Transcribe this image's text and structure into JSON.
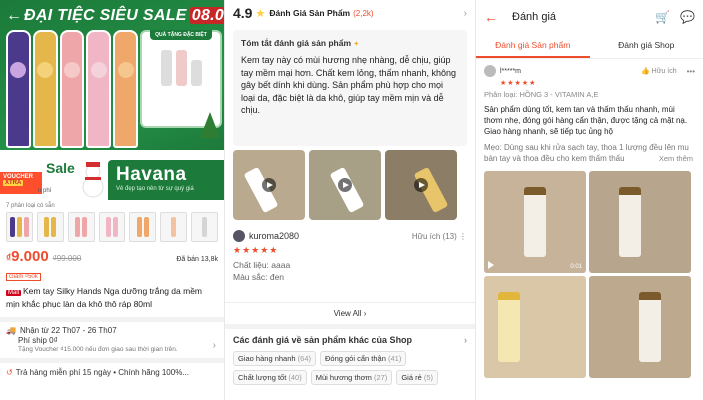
{
  "product": {
    "banner_title": "ĐẠI TIỆC SIÊU SALE",
    "banner_date": "08.08",
    "gift_tag": "QUÀ TẶNG ĐẶC BIỆT",
    "voucher": "VOUCHER",
    "voucher_xtra": "XTRA",
    "sale_label": "Sale",
    "sale_sub": "n phí",
    "brand": "Havana",
    "brand_sub": "Vẻ đẹp tạo nên từ sự quý giá",
    "variants_label": "7 phân loại có sẵn",
    "price": "9.000",
    "price_currency": "₫",
    "old_price": "₫99.000",
    "sold": "Đã bán 13,8k",
    "discount": "Giảm ₫50k",
    "mall_badge": "Mall",
    "title": "Kem tay Silky Hands Nga dưỡng trắng da mềm mịn khắc phục làn da khô thô ráp 80ml",
    "ship_date": "Nhận từ 22 Th07 - 26 Th07",
    "ship_fee": "Phí ship 0₫",
    "ship_note": "Tặng Voucher ₫15.000 nếu đơn giao sau thời gian trên.",
    "guarantee": "Trả hàng miễn phí 15 ngày  •  Chính hãng 100%..."
  },
  "reviews": {
    "score": "4.9",
    "label": "Đánh Giá Sản Phẩm",
    "count": "(2,2k)",
    "summary_title": "Tóm tắt đánh giá sản phẩm",
    "summary_text": "Kem tay này có mùi hương nhẹ nhàng, dễ chịu, giúp tay mềm mại hơn. Chất kem lỏng, thấm nhanh, không gây bết dính khi dùng. Sản phẩm phù hợp cho mọi loại da, đặc biệt là da khô, giúp tay mềm mịn và dễ chịu.",
    "reviewer": "kuroma2080",
    "helpful": "Hữu ích (13)",
    "stars": "★★★★★",
    "attr1": "Chất liệu: aaaa",
    "attr2": "Màu sắc: đen",
    "view_all": "View All",
    "other_title": "Các đánh giá về sản phẩm khác của Shop",
    "tags": [
      {
        "label": "Giao hàng nhanh",
        "count": "(64)"
      },
      {
        "label": "Đóng gói cẩn thận",
        "count": "(41)"
      },
      {
        "label": "Chất lượng tốt",
        "count": "(40)"
      },
      {
        "label": "Mùi hương thơm",
        "count": "(27)"
      },
      {
        "label": "Giá rẻ",
        "count": "(5)"
      }
    ]
  },
  "detail": {
    "title": "Đánh giá",
    "tab_product": "Đánh giá Sản phẩm",
    "tab_shop": "Đánh giá Shop",
    "user": "l*****m",
    "helpful": "Hữu ích",
    "stars": "★★★★★",
    "variant": "Phân loại: HỒNG 3 - VITAMIN A,E",
    "text": "Sản phẩm dùng tốt, kem tan và thấm thấu nhanh, mùi thơm nhẹ, đóng gói hàng cẩn thận, được tặng cả mặt nạ. Giao hàng nhanh, sẽ tiếp tục ủng hộ",
    "tip": "Mẹo: Dùng sau khi rửa sạch tay, thoa 1 lượng đều lên mu bàn tay và thoa đều cho kem thấm thấu",
    "see_more": "Xem thêm",
    "video_duration": "0:01"
  },
  "colors": {
    "accent": "#ee4d2d",
    "banner_green": "#1c7a3a",
    "star": "#ffce3d"
  }
}
